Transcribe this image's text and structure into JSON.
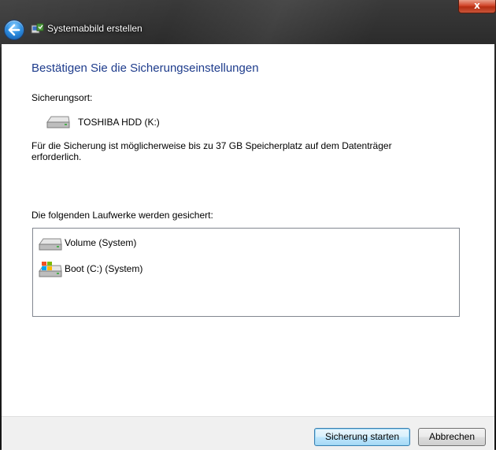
{
  "window": {
    "title": "Systemabbild erstellen",
    "close_label": "x"
  },
  "page": {
    "heading": "Bestätigen Sie die Sicherungseinstellungen",
    "location_label": "Sicherungsort:",
    "target_drive": "TOSHIBA HDD (K:)",
    "space_note_line1": "Für die Sicherung ist möglicherweise bis zu 37 GB Speicherplatz auf dem Datenträger",
    "space_note_line2": "erforderlich.",
    "drives_label": "Die folgenden Laufwerke werden gesichert:",
    "drives": [
      {
        "label": "Volume (System)",
        "icon": "hard-drive-icon"
      },
      {
        "label": "Boot (C:) (System)",
        "icon": "windows-drive-icon"
      }
    ]
  },
  "footer": {
    "start_label": "Sicherung starten",
    "cancel_label": "Abbrechen"
  }
}
